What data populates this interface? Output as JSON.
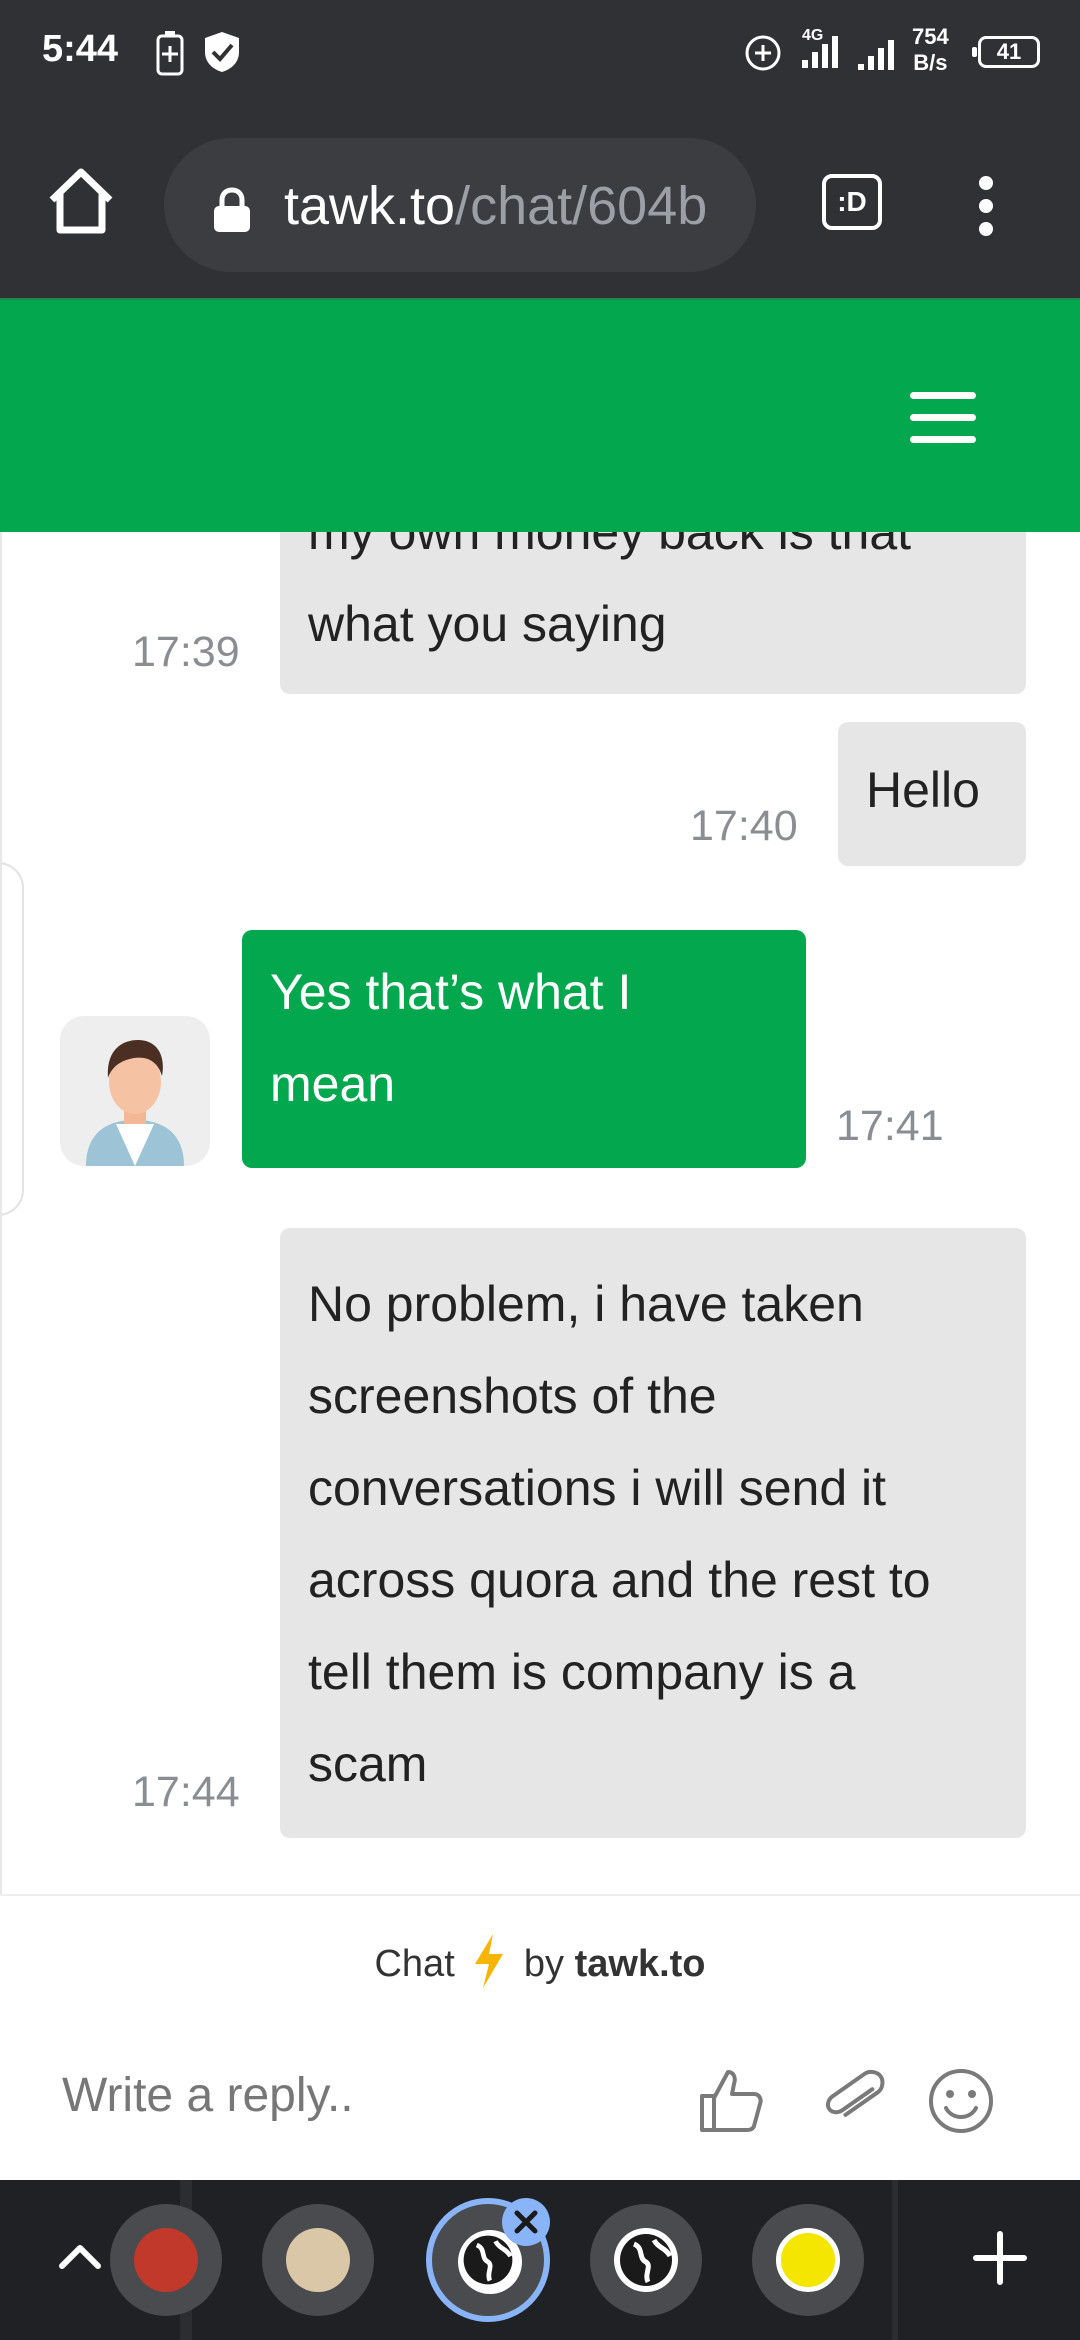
{
  "status_bar": {
    "time": "5:44",
    "network_type": "4G",
    "net_speed_value": "754",
    "net_speed_unit": "B/s",
    "battery_level": "41",
    "icons": [
      "battery-saver-icon",
      "shield-icon",
      "data-saver-icon",
      "signal-icon",
      "signal-icon-2"
    ]
  },
  "browser": {
    "url_domain": "tawk.to",
    "url_path": "/chat/604b",
    "tab_button_label": ":D"
  },
  "messages": [
    {
      "text_lines": [
        "my own money back is that",
        "what you saying"
      ],
      "time": "17:39",
      "style": "grey"
    },
    {
      "text_lines": [
        "Hello"
      ],
      "time": "17:40",
      "style": "grey"
    },
    {
      "text_lines": [
        "Yes that’s what I",
        "mean"
      ],
      "time": "17:41",
      "style": "green"
    },
    {
      "text_lines": [
        "No problem, i have taken",
        "screenshots of the",
        "conversations i will send it",
        "across quora and the rest to",
        "tell them is company is a",
        "scam"
      ],
      "time": "17:44",
      "style": "grey"
    }
  ],
  "footer": {
    "chat_label": "Chat",
    "by_label": "by",
    "brand": "tawk.to"
  },
  "reply": {
    "placeholder": "Write a reply.."
  },
  "colors": {
    "brand_green": "#03a84e",
    "bubble_grey": "#e6e6e6",
    "chrome_dark": "#303134",
    "bolt_yellow": "#f7b500"
  }
}
